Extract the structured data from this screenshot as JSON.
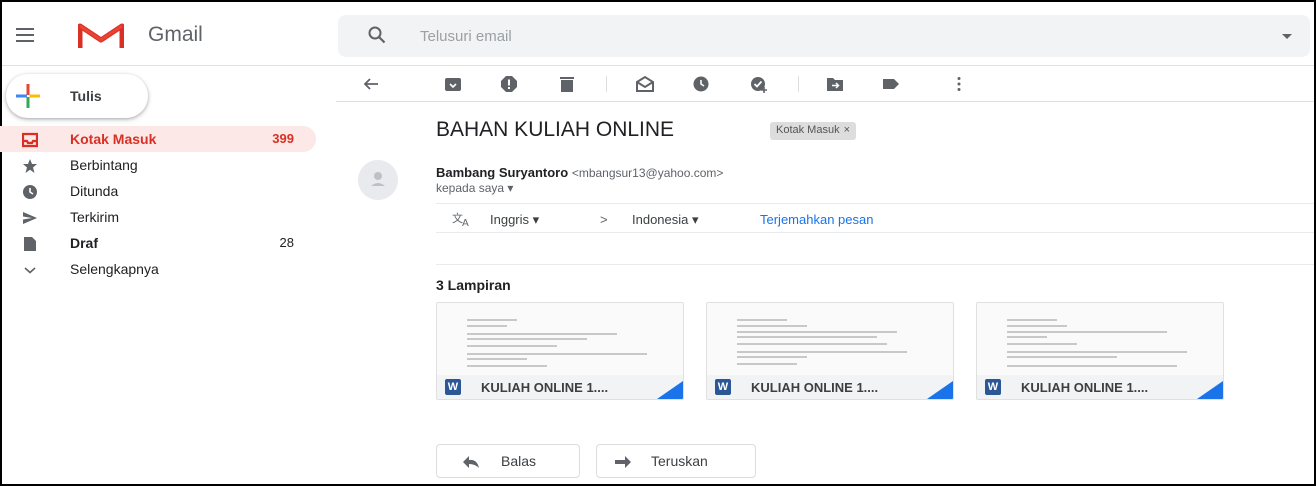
{
  "app": {
    "brand": "Gmail"
  },
  "search": {
    "placeholder": "Telusuri email"
  },
  "compose": {
    "label": "Tulis"
  },
  "sidebar": {
    "items": [
      {
        "label": "Kotak Masuk",
        "count": "399",
        "icon": "inbox-icon",
        "active": true
      },
      {
        "label": "Berbintang",
        "count": "",
        "icon": "star-icon"
      },
      {
        "label": "Ditunda",
        "count": "",
        "icon": "clock-icon"
      },
      {
        "label": "Terkirim",
        "count": "",
        "icon": "send-icon"
      },
      {
        "label": "Draf",
        "count": "28",
        "icon": "draft-icon"
      },
      {
        "label": "Selengkapnya",
        "count": "",
        "icon": "chevron-down-icon"
      }
    ]
  },
  "toolbar": {
    "icons": [
      "back-arrow-icon",
      "archive-icon",
      "report-spam-icon",
      "delete-icon",
      "mark-unread-icon",
      "snooze-icon",
      "add-task-icon",
      "move-to-icon",
      "label-icon",
      "more-icon"
    ]
  },
  "message": {
    "subject": "BAHAN KULIAH ONLINE",
    "label_chip": "Kotak Masuk",
    "label_chip_close": "×",
    "sender_name": "Bambang Suryantoro",
    "sender_email": "<mbangsur13@yahoo.com>",
    "recipient": "kepada saya"
  },
  "translate": {
    "from_lang": "Inggris",
    "arrow": ">",
    "to_lang": "Indonesia",
    "action": "Terjemahkan pesan"
  },
  "attachments": {
    "title": "3 Lampiran",
    "items": [
      {
        "name": "KULIAH ONLINE 1....",
        "type_badge": "W"
      },
      {
        "name": "KULIAH ONLINE 1....",
        "type_badge": "W"
      },
      {
        "name": "KULIAH ONLINE 1....",
        "type_badge": "W"
      }
    ]
  },
  "actions": {
    "reply": "Balas",
    "forward": "Teruskan"
  },
  "colors": {
    "accent_red": "#d93025",
    "active_bg": "#fce8e6",
    "link_blue": "#1a73e8",
    "word_blue": "#2b5797"
  }
}
